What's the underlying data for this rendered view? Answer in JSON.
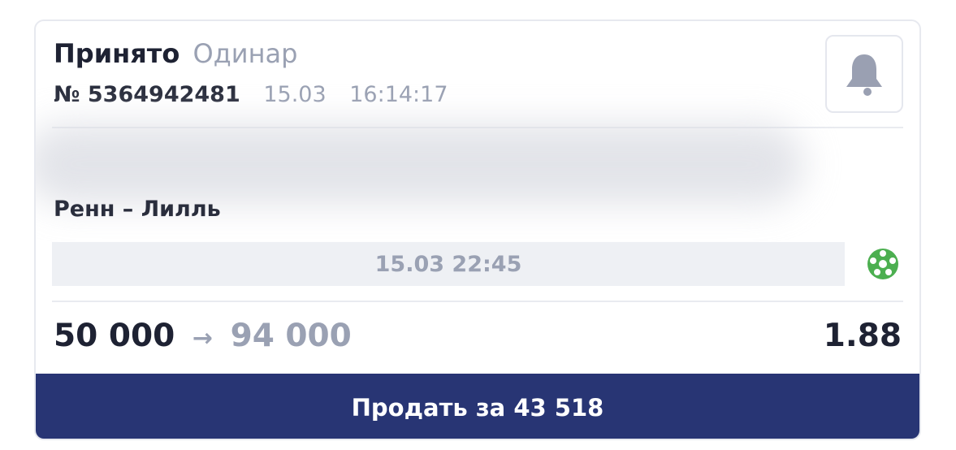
{
  "header": {
    "status": "Принято",
    "bet_type": "Одинар",
    "bet_number": "№ 5364942481",
    "date": "15.03",
    "time": "16:14:17"
  },
  "icons": {
    "bell": "bell-icon",
    "sport": "soccer-ball-icon"
  },
  "event": {
    "name": "Ренн – Лилль",
    "start": "15.03 22:45"
  },
  "bet": {
    "stake": "50 000",
    "arrow": "→",
    "payout": "94 000",
    "odds": "1.88"
  },
  "actions": {
    "sell_label": "Продать за 43 518"
  },
  "colors": {
    "accent": "#283574",
    "muted": "#9aa1b3",
    "text": "#1e2233",
    "sport_icon": "#4caf50"
  }
}
